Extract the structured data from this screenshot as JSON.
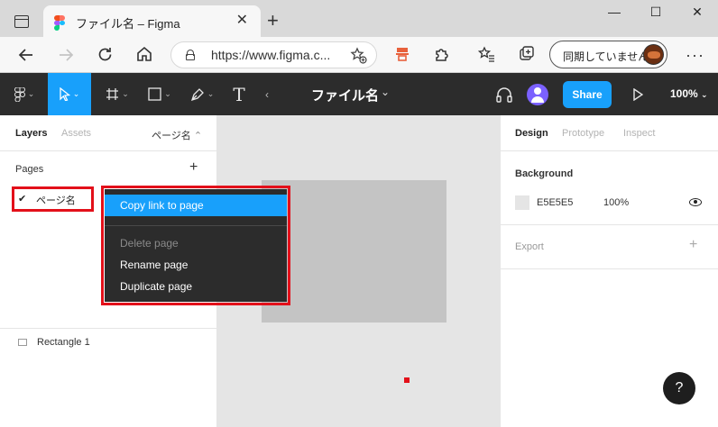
{
  "browser": {
    "tab_title": "ファイル名 – Figma",
    "tab_close": "✕",
    "new_tab": "+",
    "url": "https://www.figma.c...",
    "sync_label": "同期していません",
    "menu": "···",
    "window": {
      "minimize": "—",
      "maximize": "☐",
      "close": "✕"
    },
    "icons": [
      "tab-actions-icon",
      "figma-favicon",
      "back-icon",
      "forward-icon",
      "refresh-icon",
      "home-icon",
      "lock-icon",
      "favorite-add-icon",
      "extension-icon",
      "puzzle-icon",
      "favorites-icon",
      "collections-icon",
      "profile-avatar"
    ]
  },
  "figma": {
    "file_name": "ファイル名",
    "share_label": "Share",
    "zoom": "100%",
    "text_tool": "T",
    "accent": "#18a0fb",
    "left_panel": {
      "tabs": [
        "Layers",
        "Assets"
      ],
      "page_selector": "ページ名",
      "pages_heading": "Pages",
      "pages_add": "+",
      "current_page": "ページ名",
      "check": "✔",
      "layers": [
        "Rectangle 1"
      ]
    },
    "context_menu": {
      "items": [
        {
          "label": "Copy link to page",
          "state": "highlighted"
        },
        {
          "label": "Delete page",
          "state": "disabled"
        },
        {
          "label": "Rename page",
          "state": "normal"
        },
        {
          "label": "Duplicate page",
          "state": "normal"
        }
      ]
    },
    "right_panel": {
      "tabs": [
        "Design",
        "Prototype",
        "Inspect"
      ],
      "background_heading": "Background",
      "background_hex": "E5E5E5",
      "background_opacity": "100%",
      "export_heading": "Export",
      "export_add": "+"
    },
    "help": "?"
  },
  "highlight_color": "#e3101a"
}
